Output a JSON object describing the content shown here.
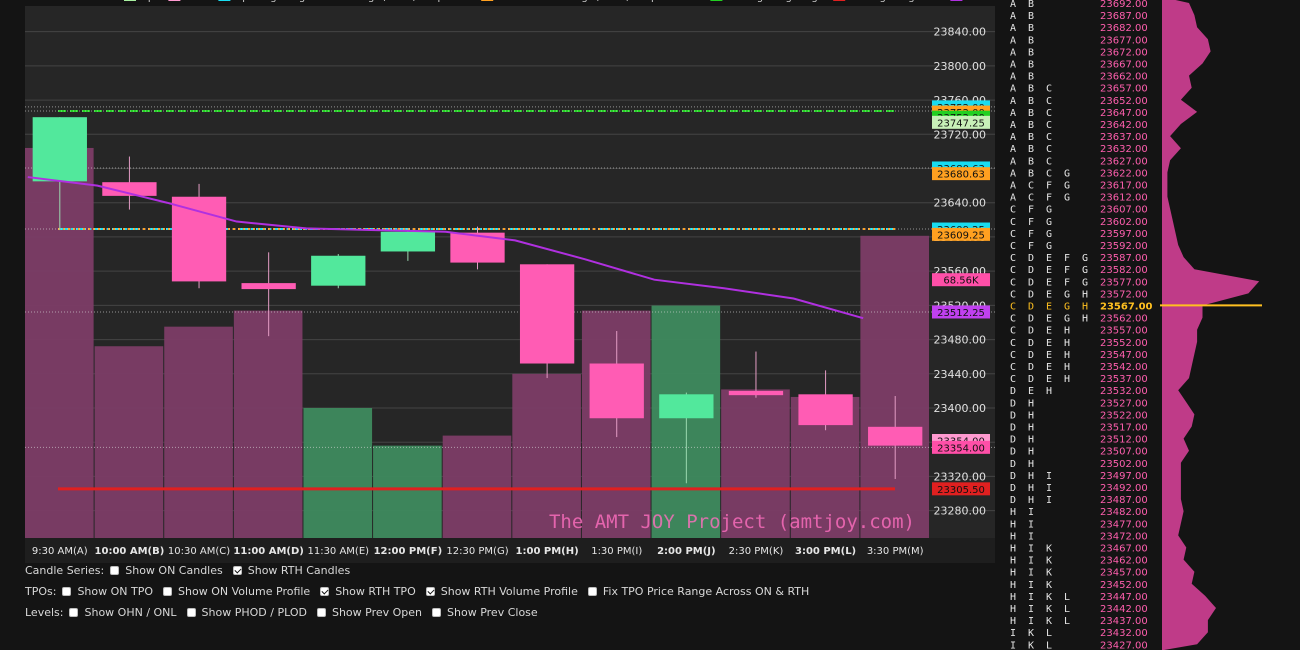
{
  "legend": {
    "items": [
      {
        "label": "Open",
        "color": "#a8f0a0"
      },
      {
        "label": "Close",
        "color": "#ff9ad0"
      },
      {
        "label": "Opening Range Balance High / Low / Midpoint",
        "color": "#19dcf0"
      },
      {
        "label": "Initial Balance High / Low / Midpoint",
        "color": "#ffa020"
      },
      {
        "label": "Trading Range High",
        "color": "#22d022"
      },
      {
        "label": "Trading Range Low",
        "color": "#e02020"
      },
      {
        "label": "VWAP",
        "color": "#b030e0"
      }
    ]
  },
  "watermark": "The AMT JOY Project (amtjoy.com)",
  "chart_data": {
    "type": "candlestick",
    "y_range": [
      23248,
      23870
    ],
    "y_ticks": [
      23280,
      23320,
      23360,
      23400,
      23440,
      23480,
      23520,
      23560,
      23600,
      23640,
      23680,
      23720,
      23760,
      23800,
      23840
    ],
    "y_tick_labels": [
      "23280.00",
      "23320.00",
      "23360.00",
      "23400.00",
      "23440.00",
      "23480.00",
      "23520.00",
      "23560.00",
      "23600.00",
      "23640.00",
      "23680.00",
      "23720.00",
      "23760.00",
      "23800.00",
      "23840.00"
    ],
    "grid": true,
    "categories": [
      "9:30 AM(A)",
      "10:00 AM(B)",
      "10:30 AM(C)",
      "11:00 AM(D)",
      "11:30 AM(E)",
      "12:00 PM(F)",
      "12:30 PM(G)",
      "1:00 PM(H)",
      "1:30 PM(I)",
      "2:00 PM(J)",
      "2:30 PM(K)",
      "3:00 PM(L)",
      "3:30 PM(M)"
    ],
    "bold_categories": [
      false,
      true,
      false,
      true,
      false,
      true,
      false,
      true,
      false,
      true,
      false,
      true,
      false
    ],
    "candles": [
      {
        "o": 23665,
        "h": 23740,
        "l": 23608,
        "c": 23740
      },
      {
        "o": 23664,
        "h": 23694,
        "l": 23632,
        "c": 23648
      },
      {
        "o": 23647,
        "h": 23662,
        "l": 23540,
        "c": 23548
      },
      {
        "o": 23546,
        "h": 23582,
        "l": 23484,
        "c": 23539
      },
      {
        "o": 23543,
        "h": 23580,
        "l": 23540,
        "c": 23578
      },
      {
        "o": 23583,
        "h": 23610,
        "l": 23572,
        "c": 23606
      },
      {
        "o": 23605,
        "h": 23612,
        "l": 23562,
        "c": 23570
      },
      {
        "o": 23568,
        "h": 23568,
        "l": 23435,
        "c": 23452
      },
      {
        "o": 23452,
        "h": 23490,
        "l": 23366,
        "c": 23388
      },
      {
        "o": 23388,
        "h": 23418,
        "l": 23312,
        "c": 23416
      },
      {
        "o": 23420,
        "h": 23466,
        "l": 23412,
        "c": 23415
      },
      {
        "o": 23416,
        "h": 23444,
        "l": 23374,
        "c": 23380
      },
      {
        "o": 23378,
        "h": 23414,
        "l": 23317,
        "c": 23356
      }
    ],
    "volume": {
      "max": 100,
      "values": [
        77.7,
        38.2,
        42.1,
        45.3,
        25.9,
        18.4,
        20.4,
        32.7,
        45.3,
        46.3,
        29.6,
        28.1,
        60.2
      ],
      "up": [
        false,
        false,
        false,
        false,
        true,
        true,
        false,
        false,
        false,
        true,
        false,
        false,
        false
      ]
    },
    "vwap": [
      23670,
      23660,
      23640,
      23618,
      23610,
      23608,
      23606,
      23596,
      23574,
      23550,
      23540,
      23528,
      23505
    ],
    "levels": [
      {
        "name": "Opening Range High",
        "value": 23747.25,
        "color": "#19dcf0",
        "style": "dash"
      },
      {
        "name": "Initial Balance High",
        "value": 23747.25,
        "color": "#ffa020",
        "style": "dash"
      },
      {
        "name": "Trading Range High",
        "value": 23747.25,
        "color": "#22d022",
        "style": "dash"
      },
      {
        "name": "Opening Range Low",
        "value": 23609.25,
        "color": "#19dcf0",
        "style": "dashdot"
      },
      {
        "name": "Initial Balance Low",
        "value": 23609.25,
        "color": "#ffa020",
        "style": "dot"
      },
      {
        "name": "Trading Range Low",
        "value": 23305.5,
        "color": "#e02020",
        "style": "solid"
      }
    ],
    "price_labels": [
      {
        "text": "23752.00",
        "value": 23752,
        "bg": "#19dcf0"
      },
      {
        "text": "23752.00",
        "value": 23746,
        "bg": "#ffa020"
      },
      {
        "text": "23752.00",
        "value": 23740,
        "bg": "#22d022"
      },
      {
        "text": "23747.25",
        "value": 23734,
        "bg": "#c8f0b8"
      },
      {
        "text": "23680.63",
        "value": 23680.63,
        "bg": "#19dcf0"
      },
      {
        "text": "23680.63",
        "value": 23674,
        "bg": "#ffa020"
      },
      {
        "text": "23609.25",
        "value": 23609.25,
        "bg": "#19dcf0"
      },
      {
        "text": "23609.25",
        "value": 23603,
        "bg": "#ffa020"
      },
      {
        "text": "68.56K",
        "value": 23550,
        "bg": "#ff4fa8"
      },
      {
        "text": "23512.25",
        "value": 23512.25,
        "bg": "#c040f0"
      },
      {
        "text": "23354.00",
        "value": 23362,
        "bg": "#ff9ad0"
      },
      {
        "text": "23354.00",
        "value": 23354,
        "bg": "#ff4fa8"
      },
      {
        "text": "23305.50",
        "value": 23305.5,
        "bg": "#e02020"
      }
    ],
    "profile": {
      "prices": [
        "23692.00",
        "23687.00",
        "23682.00",
        "23677.00",
        "23672.00",
        "23667.00",
        "23662.00",
        "23657.00",
        "23652.00",
        "23647.00",
        "23642.00",
        "23637.00",
        "23632.00",
        "23627.00",
        "23622.00",
        "23617.00",
        "23612.00",
        "23607.00",
        "23602.00",
        "23597.00",
        "23592.00",
        "23587.00",
        "23582.00",
        "23577.00",
        "23572.00",
        "23567.00",
        "23562.00",
        "23557.00",
        "23552.00",
        "23547.00",
        "23542.00",
        "23537.00",
        "23532.00",
        "23527.00",
        "23522.00",
        "23517.00",
        "23512.00",
        "23507.00",
        "23502.00",
        "23497.00",
        "23492.00",
        "23487.00",
        "23482.00",
        "23477.00",
        "23472.00",
        "23467.00",
        "23462.00",
        "23457.00",
        "23452.00",
        "23447.00",
        "23442.00",
        "23437.00",
        "23432.00",
        "23427.00"
      ],
      "letters": [
        [
          "A",
          "B"
        ],
        [
          "A",
          "B"
        ],
        [
          "A",
          "B"
        ],
        [
          "A",
          "B"
        ],
        [
          "A",
          "B"
        ],
        [
          "A",
          "B"
        ],
        [
          "A",
          "B"
        ],
        [
          "A",
          "B",
          "C"
        ],
        [
          "A",
          "B",
          "C"
        ],
        [
          "A",
          "B",
          "C"
        ],
        [
          "A",
          "B",
          "C"
        ],
        [
          "A",
          "B",
          "C"
        ],
        [
          "A",
          "B",
          "C"
        ],
        [
          "A",
          "B",
          "C"
        ],
        [
          "A",
          "B",
          "C",
          "G"
        ],
        [
          "A",
          "C",
          "F",
          "G"
        ],
        [
          "A",
          "C",
          "F",
          "G"
        ],
        [
          "C",
          "F",
          "G"
        ],
        [
          "C",
          "F",
          "G"
        ],
        [
          "C",
          "F",
          "G"
        ],
        [
          "C",
          "F",
          "G"
        ],
        [
          "C",
          "D",
          "E",
          "F",
          "G"
        ],
        [
          "C",
          "D",
          "E",
          "F",
          "G"
        ],
        [
          "C",
          "D",
          "E",
          "F",
          "G"
        ],
        [
          "C",
          "D",
          "E",
          "G",
          "H"
        ],
        [
          "C",
          "D",
          "E",
          "G",
          "H"
        ],
        [
          "C",
          "D",
          "E",
          "G",
          "H"
        ],
        [
          "C",
          "D",
          "E",
          "H"
        ],
        [
          "C",
          "D",
          "E",
          "H"
        ],
        [
          "C",
          "D",
          "E",
          "H"
        ],
        [
          "C",
          "D",
          "E",
          "H"
        ],
        [
          "C",
          "D",
          "E",
          "H"
        ],
        [
          "D",
          "E",
          "H"
        ],
        [
          "D",
          "H"
        ],
        [
          "D",
          "H"
        ],
        [
          "D",
          "H"
        ],
        [
          "D",
          "H"
        ],
        [
          "D",
          "H"
        ],
        [
          "D",
          "H"
        ],
        [
          "D",
          "H",
          "I"
        ],
        [
          "D",
          "H",
          "I"
        ],
        [
          "D",
          "H",
          "I"
        ],
        [
          "H",
          "I"
        ],
        [
          "H",
          "I"
        ],
        [
          "H",
          "I"
        ],
        [
          "H",
          "I",
          "K"
        ],
        [
          "H",
          "I",
          "K"
        ],
        [
          "H",
          "I",
          "K"
        ],
        [
          "H",
          "I",
          "K"
        ],
        [
          "H",
          "I",
          "K",
          "L"
        ],
        [
          "H",
          "I",
          "K",
          "L"
        ],
        [
          "H",
          "I",
          "K",
          "L"
        ],
        [
          "I",
          "K",
          "L"
        ],
        [
          "I",
          "K",
          "L"
        ]
      ],
      "poc_index": 25,
      "volumes": [
        20,
        24,
        26,
        34,
        36,
        30,
        20,
        22,
        14,
        26,
        14,
        6,
        14,
        6,
        4,
        4,
        4,
        6,
        8,
        10,
        12,
        16,
        24,
        72,
        64,
        30,
        30,
        26,
        26,
        24,
        22,
        20,
        12,
        18,
        24,
        22,
        16,
        20,
        14,
        14,
        14,
        14,
        16,
        14,
        12,
        18,
        16,
        24,
        22,
        32,
        40,
        34,
        34,
        26
      ],
      "poc_color": "#ffc020",
      "letter_color": "#e6e6e6",
      "price_color": "#ff5fae"
    }
  },
  "controls": {
    "candle_series": {
      "label": "Candle Series:",
      "options": [
        {
          "label": "Show ON Candles",
          "checked": false
        },
        {
          "label": "Show RTH Candles",
          "checked": true
        }
      ]
    },
    "tpos": {
      "label": "TPOs:",
      "options": [
        {
          "label": "Show ON TPO",
          "checked": false
        },
        {
          "label": "Show ON Volume Profile",
          "checked": false
        },
        {
          "label": "Show RTH TPO",
          "checked": true
        },
        {
          "label": "Show RTH Volume Profile",
          "checked": true
        },
        {
          "label": "Fix TPO Price Range Across ON & RTH",
          "checked": false
        }
      ]
    },
    "levels": {
      "label": "Levels:",
      "options": [
        {
          "label": "Show OHN / ONL",
          "checked": false
        },
        {
          "label": "Show PHOD / PLOD",
          "checked": false
        },
        {
          "label": "Show Prev Open",
          "checked": false
        },
        {
          "label": "Show Prev Close",
          "checked": false
        }
      ]
    }
  }
}
